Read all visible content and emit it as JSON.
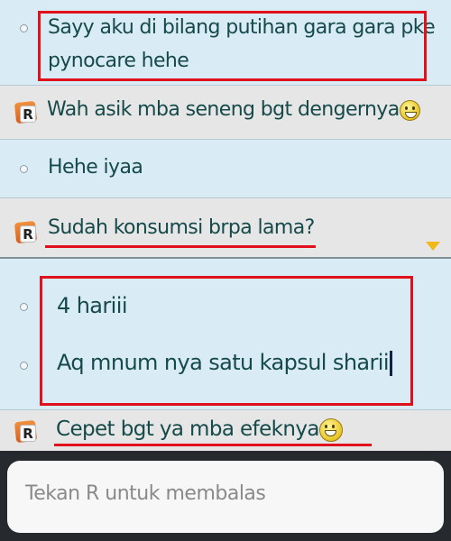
{
  "messages": [
    {
      "sender": "me",
      "lines": [
        "Sayy aku di bilang putihan gara gara pke",
        "pynocare hehe"
      ],
      "highlight": "box"
    },
    {
      "sender": "them",
      "text": "Wah asik mba seneng bgt dengernya",
      "emoji": "grin-icon"
    },
    {
      "sender": "me",
      "text": "Hehe iyaa"
    },
    {
      "sender": "them",
      "text": "Sudah konsumsi brpa lama?",
      "highlight": "underline"
    },
    {
      "sender": "me",
      "text": "4 hariii",
      "highlight": "box"
    },
    {
      "sender": "me",
      "text": "Aq mnum nya satu kapsul sharii",
      "highlight": "box"
    },
    {
      "sender": "them",
      "text": "Cepet bgt ya mba efeknya",
      "emoji": "grin-icon",
      "highlight": "underline"
    }
  ],
  "sender_badge": "R",
  "reply_input": {
    "placeholder": "Tekan R untuk membalas"
  },
  "colors": {
    "highlight": "#e0101c",
    "text": "#164a4a",
    "scroll_arrow": "#f2b816"
  }
}
